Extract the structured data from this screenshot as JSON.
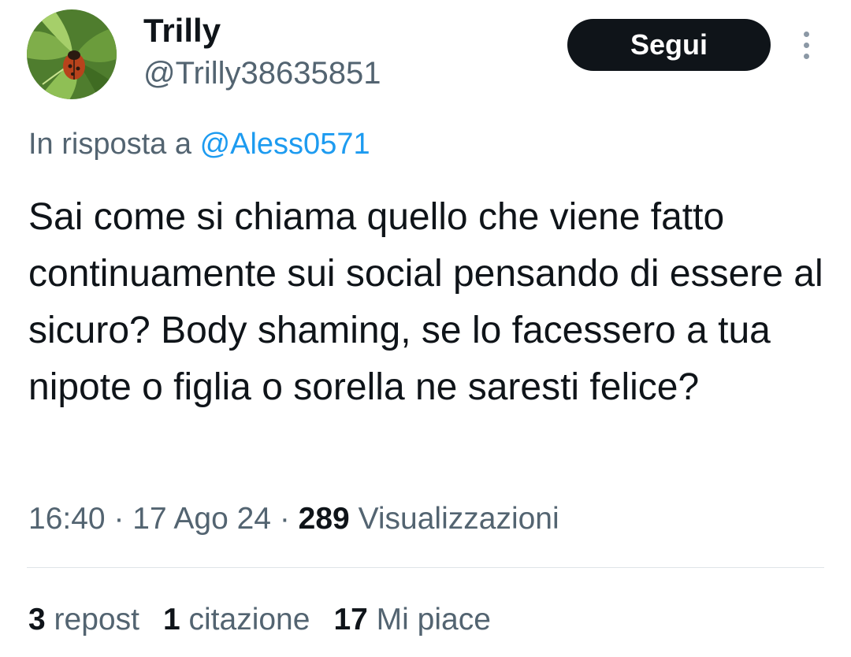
{
  "author": {
    "display_name": "Trilly",
    "handle": "@Trilly38635851"
  },
  "follow_button": {
    "label": "Segui"
  },
  "reply_context": {
    "prefix": "In risposta a",
    "mention": "@Aless0571"
  },
  "tweet": {
    "text": "Sai come si chiama quello che viene fatto continuamente sui social pensando di essere al sicuro? Body shaming, se lo facessero a tua nipote o figlia o sorella ne saresti felice?",
    "time": "16:40",
    "date": "17 Ago 24",
    "separator": "·",
    "views_count": "289",
    "views_label": "Visualizzazioni"
  },
  "stats": {
    "reposts": {
      "count": "3",
      "label": "repost"
    },
    "quotes": {
      "count": "1",
      "label": "citazione"
    },
    "likes": {
      "count": "17",
      "label": "Mi piace"
    }
  },
  "icons": {
    "more": "more-vertical-icon",
    "avatar": "ladybug-on-leaf-avatar"
  },
  "colors": {
    "text_primary": "#0f1419",
    "text_secondary": "#536471",
    "link": "#1d9bf0",
    "button_bg": "#0f1419",
    "button_text": "#ffffff",
    "divider": "#dfe4e8"
  }
}
